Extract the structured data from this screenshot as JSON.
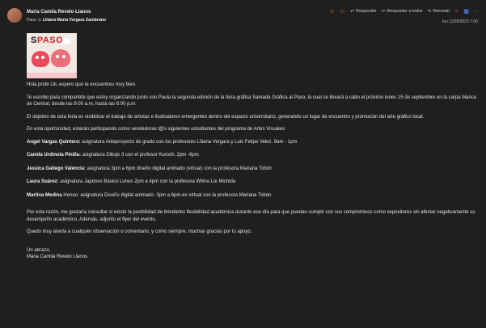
{
  "header": {
    "sender": "Maria Camila Revelo Llanos",
    "to_label": "Para:",
    "recipient": "Liliana Maria Vergara Zambrano",
    "date": "lun 11/09/2023 7:00",
    "actions": {
      "reply": "Responder",
      "reply_all": "Responder a todos",
      "forward": "Reenviar",
      "more": "⋯"
    }
  },
  "flyer": {
    "title_a": "S",
    "title_b": "PASO"
  },
  "body": {
    "greeting": "Hola profe Lili, espero que te encuentres muy bien.",
    "p1": "Te escribo para compartirte que estoy organizando junto con Paula la segunda edición de la feria gráfica Samada Gráfica al Paso, la cual se llevará a cabo el próximo lunes 15 de septiembre en la carpa blanca de Central, desde las 9:00 a.m. hasta las 6:00 p.m.",
    "p2": "El objetivo de esta feria es visibilizar el trabajo de artistas e ilustradores emergentes dentro del espacio universitario, generando un lugar de encuentro y promoción del arte gráfico local.",
    "p3": "En esta oportunidad, estarán participando como vendedoras l@s siguientes estudiantes del programa de Artes Visuales:",
    "students": [
      {
        "name": "Angel Vargas Quintero:",
        "detail": " asignatura Anteproyecto de grado con los profesores Liliana Vergara y Luis Felipe Velez. 9am - 1pm"
      },
      {
        "name": "Camila Urdinola Pinilla:",
        "detail": " asignatura Dibujo 3 con el profesor Kurosh. 2pm -6pm"
      },
      {
        "name": "Jessica Gallego Valencia:",
        "detail": " asignatura 3pm a 6pm diseño digital animado (virtual) con la profesora Mariana Tobón"
      },
      {
        "name": "Laura Suárez:",
        "detail": " asignatura Japones Básico Lunes 2pm a 4pm con la profesora Wilma Lie Michida"
      },
      {
        "name": "Martina Medina",
        "detail": " Henao: asignatura Diseño digital animado- 3pm a 6pm-es virtual con la profesora Mariana Tobón"
      }
    ],
    "p4": "Por esta razón, me gustaría consultar si existe la posibilidad de brindarles flexibilidad académica durante ese día para que puedan cumplir con sus compromisos como expositores sin afectar negativamente su desempeño académico. Además, adjunto el flyer del evento.",
    "p5": "Quedo muy atenta a cualquier observación o comentario, y como siempre, muchas gracias por tu apoyo.",
    "closing": "Un abrazo,",
    "signature": "Maria Camila Revelo Llanos"
  },
  "colors": {
    "background": "#1f1f1f",
    "text": "#e2e2e2",
    "accent_red": "#d41f2a",
    "teams_red": "#cc4444",
    "apps_blue": "#5b8bff"
  }
}
